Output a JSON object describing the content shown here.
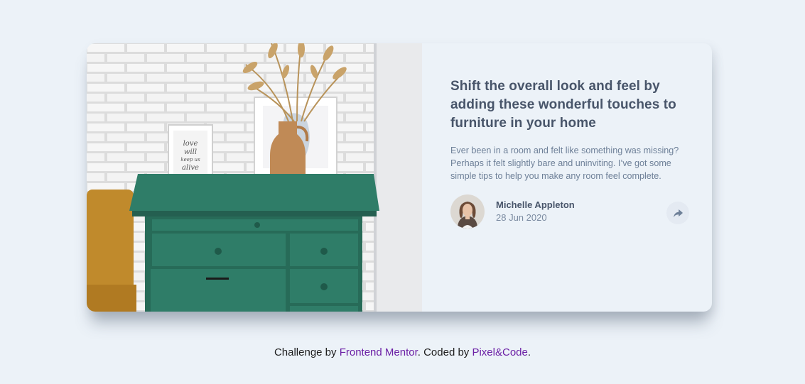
{
  "article": {
    "title": "Shift the overall look and feel by adding these wonderful touches to furniture in your home",
    "description": "Ever been in a room and felt like something was missing? Perhaps it felt slightly bare and uninviting. I’ve got some simple tips to help you make any room feel complete.",
    "author_name": "Michelle Appleton",
    "date": "28 Jun 2020",
    "share_icon": "share-icon",
    "photo_text": "love will keep us alive"
  },
  "attribution": {
    "prefix": "Challenge by ",
    "link1": "Frontend Mentor",
    "middle": ". Coded by ",
    "link2": "Pixel&Code",
    "suffix": "."
  },
  "colors": {
    "background": "#ecf2f8",
    "title": "#48556a",
    "text": "#6e8098",
    "dresser": "#2e7a66",
    "link": "#6b1fa5"
  }
}
